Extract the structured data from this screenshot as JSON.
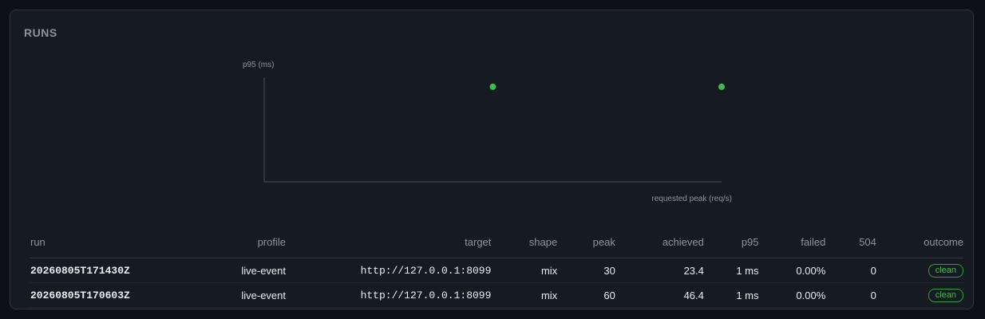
{
  "panel": {
    "title": "RUNS"
  },
  "chart_data": {
    "type": "scatter",
    "ylabel": "p95 (ms)",
    "xlabel": "requested peak (req/s)",
    "points": [
      {
        "x": 30,
        "y": 1
      },
      {
        "x": 60,
        "y": 1
      }
    ],
    "color": "#3fb950"
  },
  "table": {
    "columns": [
      "run",
      "profile",
      "target",
      "shape",
      "peak",
      "achieved",
      "p95",
      "failed",
      "504",
      "outcome"
    ],
    "rows": [
      {
        "run": "20260805T171430Z",
        "profile": "live-event",
        "target": "http://127.0.0.1:8099",
        "shape": "mix",
        "peak": "30",
        "achieved": "23.4",
        "p95": "1 ms",
        "failed": "0.00%",
        "r504": "0",
        "outcome": "clean"
      },
      {
        "run": "20260805T170603Z",
        "profile": "live-event",
        "target": "http://127.0.0.1:8099",
        "shape": "mix",
        "peak": "60",
        "achieved": "46.4",
        "p95": "1 ms",
        "failed": "0.00%",
        "r504": "0",
        "outcome": "clean"
      }
    ]
  }
}
